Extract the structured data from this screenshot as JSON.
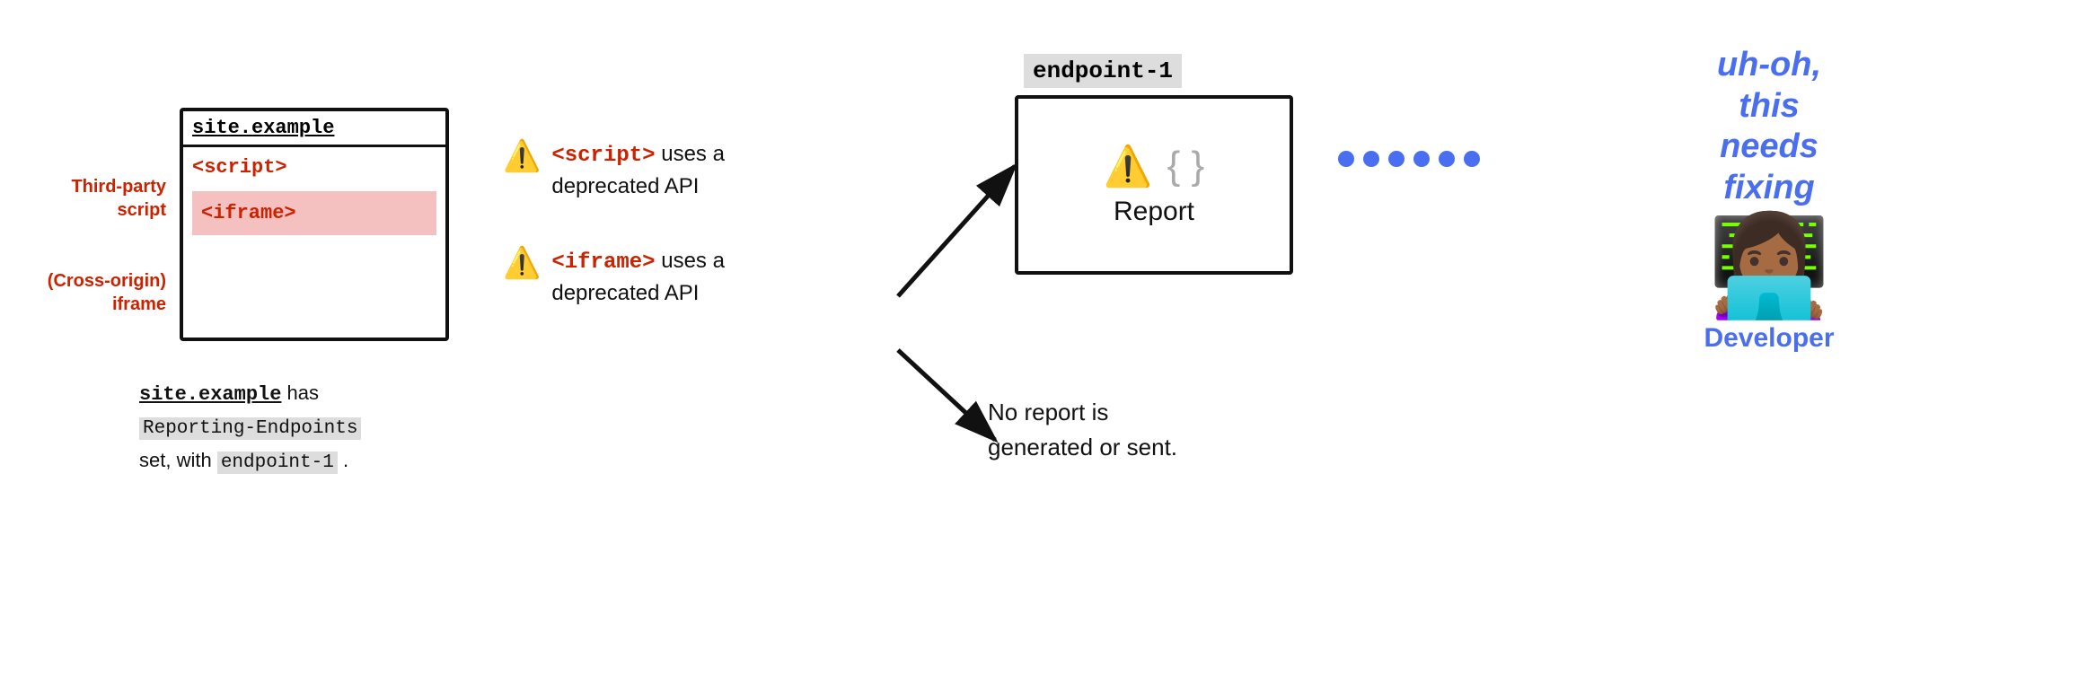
{
  "browser": {
    "titlebar": "site.example",
    "script_tag": "<script>",
    "iframe_tag": "<iframe>"
  },
  "labels": {
    "third_party": "Third-party\nscript",
    "cross_origin": "(Cross-origin)\niframe"
  },
  "caption": {
    "line1_code": "site.example",
    "line1_text": " has",
    "line2_code": "Reporting-Endpoints",
    "line3_text": "set, with",
    "line3_code": "endpoint-1",
    "line3_end": " ."
  },
  "warnings": [
    {
      "icon": "⚠️",
      "tag": "<script>",
      "text": " uses a\ndeprecated API"
    },
    {
      "icon": "⚠️",
      "tag": "<iframe>",
      "text": " uses a\ndeprecated API"
    }
  ],
  "endpoint": {
    "label": "endpoint-1",
    "icon_warning": "⚠️",
    "icon_braces": "{ }",
    "report_text": "Report"
  },
  "no_report": {
    "text": "No report is\ngenerated or sent."
  },
  "developer": {
    "uh_oh": "uh-oh,\nthis\nneeds\nfixing",
    "emoji": "👩🏾‍💻",
    "label": "Developer"
  },
  "dots": [
    "●",
    "●",
    "●",
    "●",
    "●",
    "●"
  ],
  "colors": {
    "red": "#cc2200",
    "blue": "#4a6ef0",
    "arrow": "#111111",
    "dot_blue": "#4a6ef0"
  }
}
